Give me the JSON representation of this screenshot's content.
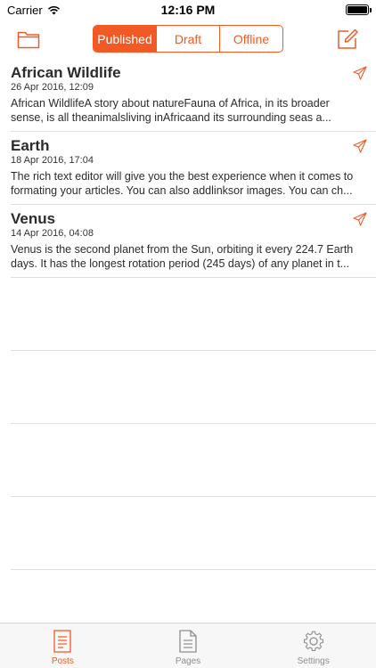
{
  "status_bar": {
    "carrier": "Carrier",
    "time": "12:16 PM"
  },
  "nav": {
    "segments": [
      {
        "label": "Published",
        "active": true
      },
      {
        "label": "Draft",
        "active": false
      },
      {
        "label": "Offline",
        "active": false
      }
    ],
    "left_icon": "folder-icon",
    "right_icon": "compose-icon"
  },
  "posts": [
    {
      "title": "African Wildlife",
      "date": "26 Apr 2016, 12:09",
      "excerpt": "African WildlifeA story about natureFauna of Africa, in its broader sense, is all theanimalsliving inAfricaand its surrounding seas a...",
      "status_icon": "paper-plane-icon"
    },
    {
      "title": "Earth",
      "date": "18 Apr 2016, 17:04",
      "excerpt": "The rich text editor will give you the best experience when it comes to formating your articles. You can also addlinksor images. You can ch...",
      "status_icon": "paper-plane-icon"
    },
    {
      "title": "Venus",
      "date": "14 Apr 2016, 04:08",
      "excerpt": "Venus is the second planet from the Sun, orbiting it every 224.7 Earth days. It has the longest rotation period (245 days) of any planet in t...",
      "status_icon": "paper-plane-icon"
    }
  ],
  "tabs": [
    {
      "label": "Posts",
      "icon": "posts-icon",
      "active": true
    },
    {
      "label": "Pages",
      "icon": "pages-icon",
      "active": false
    },
    {
      "label": "Settings",
      "icon": "settings-gear-icon",
      "active": false
    }
  ],
  "colors": {
    "accent": "#f15a24",
    "inactive": "#8e8e93",
    "separator": "#e0e0e0"
  }
}
